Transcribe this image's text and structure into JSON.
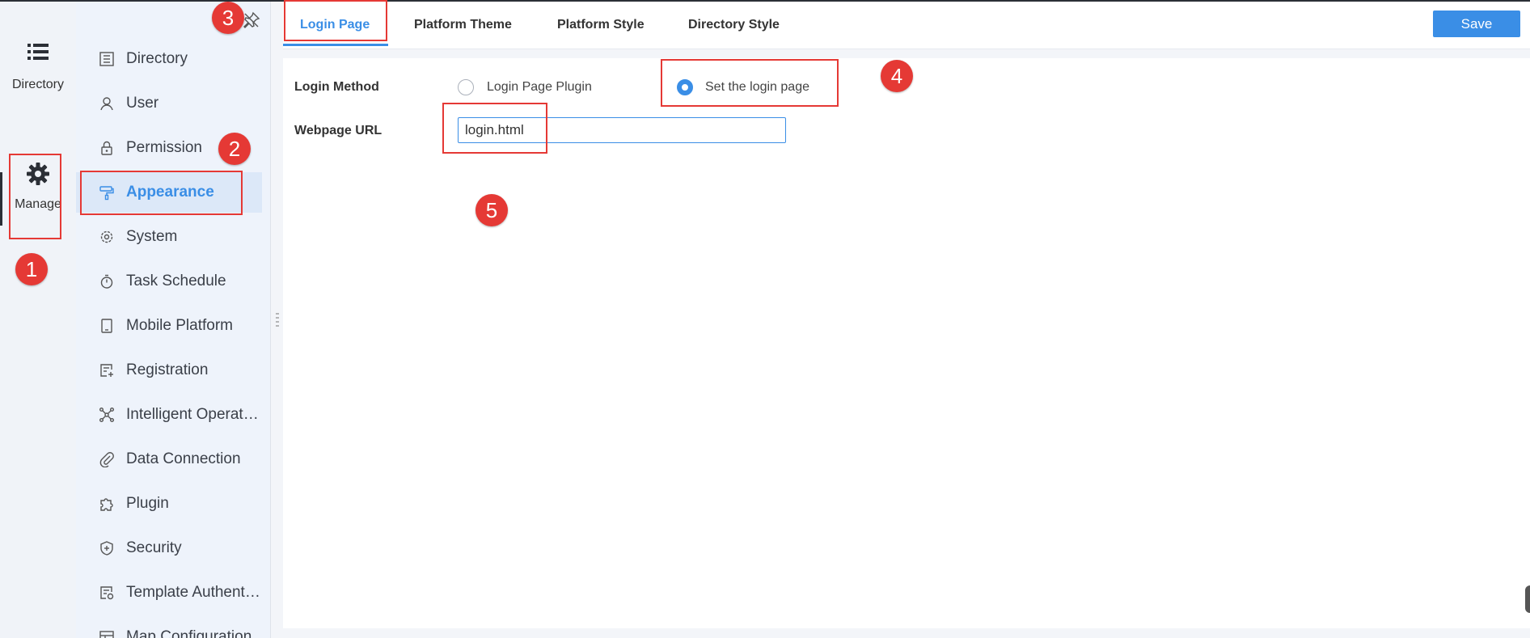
{
  "rail": {
    "items": [
      {
        "label": "Directory",
        "icon": "list-icon"
      },
      {
        "label": "Manage",
        "icon": "gear-icon"
      }
    ]
  },
  "nav": {
    "items": [
      {
        "label": "Directory",
        "icon": "directory-icon"
      },
      {
        "label": "User",
        "icon": "user-icon"
      },
      {
        "label": "Permission",
        "icon": "lock-icon"
      },
      {
        "label": "Appearance",
        "icon": "paint-roller-icon",
        "active": true
      },
      {
        "label": "System",
        "icon": "gear-icon"
      },
      {
        "label": "Task Schedule",
        "icon": "stopwatch-icon"
      },
      {
        "label": "Mobile Platform",
        "icon": "tablet-icon"
      },
      {
        "label": "Registration",
        "icon": "registration-icon"
      },
      {
        "label": "Intelligent Operat…",
        "icon": "network-icon"
      },
      {
        "label": "Data Connection",
        "icon": "paperclip-icon"
      },
      {
        "label": "Plugin",
        "icon": "puzzle-icon"
      },
      {
        "label": "Security",
        "icon": "shield-icon"
      },
      {
        "label": "Template Authent…",
        "icon": "template-icon"
      },
      {
        "label": "Map Configuration",
        "icon": "map-icon"
      }
    ]
  },
  "tabs": [
    {
      "label": "Login Page",
      "active": true
    },
    {
      "label": "Platform Theme"
    },
    {
      "label": "Platform Style"
    },
    {
      "label": "Directory Style"
    }
  ],
  "toolbar": {
    "save_label": "Save"
  },
  "form": {
    "login_method_label": "Login Method",
    "option_plugin": "Login Page Plugin",
    "option_set_page": "Set the login page",
    "selected_option": "Set the login page",
    "webpage_url_label": "Webpage URL",
    "webpage_url_value": "login.html"
  },
  "annotations": [
    "1",
    "2",
    "3",
    "4",
    "5"
  ],
  "colors": {
    "accent": "#3a8ee6",
    "annotation": "#e53935",
    "nav_bg": "#eef3fb",
    "active_nav_bg": "#dce8f8"
  }
}
